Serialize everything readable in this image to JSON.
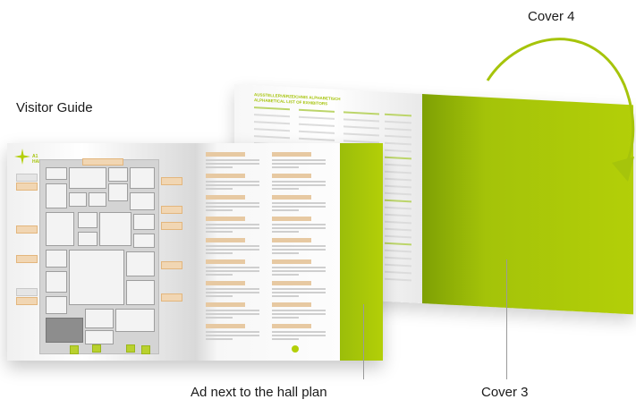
{
  "labels": {
    "visitor_guide": "Visitor Guide",
    "cover4": "Cover 4",
    "ad_next_to_hall_plan": "Ad next to the hall plan",
    "cover3": "Cover 3"
  },
  "back_spread": {
    "title_line1": "AUSSTELLERVERZEICHNIS ALPHABETISCH",
    "title_line2": "ALPHABETICAL LIST OF EXHIBITORS"
  },
  "front_spread": {
    "plan_title_line1": "A1",
    "plan_title_line2": "HALLE · HALL"
  },
  "colors": {
    "accent_green": "#b3cf08",
    "arrow_green": "#a6c40b"
  }
}
